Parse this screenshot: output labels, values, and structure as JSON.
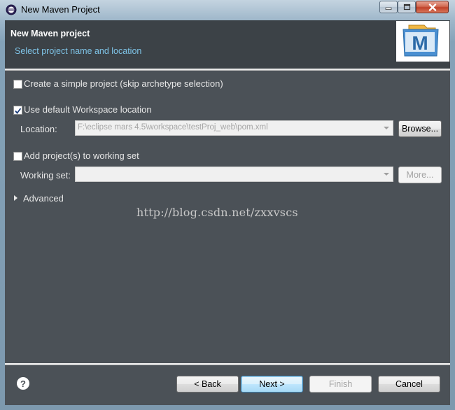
{
  "window": {
    "title": "New Maven Project"
  },
  "header": {
    "title": "New Maven project",
    "subtitle": "Select project name and location",
    "logo_letter": "M"
  },
  "options": {
    "simple_project_label": "Create a simple project (skip archetype selection)",
    "simple_project_checked": false,
    "default_workspace_label": "Use default Workspace location",
    "default_workspace_checked": true,
    "location_label": "Location:",
    "location_value": "F:\\eclipse mars 4.5\\workspace\\testProj_web\\pom.xml",
    "browse_label": "Browse...",
    "working_set_checkbox_label": "Add project(s) to working set",
    "working_set_checked": false,
    "working_set_label": "Working set:",
    "working_set_value": "",
    "more_label": "More...",
    "advanced_label": "Advanced"
  },
  "watermark": "http://blog.csdn.net/zxxvscs",
  "footer": {
    "back_label": "< Back",
    "next_label": "Next >",
    "finish_label": "Finish",
    "cancel_label": "Cancel"
  },
  "colors": {
    "accent_subtitle": "#7ec3e6",
    "dialog_bg": "#4b5157"
  }
}
